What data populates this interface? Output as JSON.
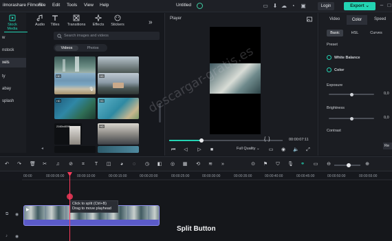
{
  "app": {
    "name": "ilmorashare Filmora",
    "menu": [
      "File",
      "Edit",
      "Tools",
      "View",
      "Help"
    ],
    "project_title": "Untitled",
    "login_label": "Login",
    "export_label": "Export"
  },
  "sidebar": {
    "items": [
      "w",
      "nstock",
      "xels",
      "ty",
      "abay",
      "splash"
    ]
  },
  "media_tabs": [
    "Stock Media",
    "Audio",
    "Titles",
    "Transitions",
    "Effects",
    "Stickers"
  ],
  "search": {
    "placeholder": "Search images and videos"
  },
  "media_type_tabs": {
    "videos": "Videos",
    "photos": "Photos"
  },
  "thumbnails": [
    {
      "badge": ""
    },
    {
      "badge": ""
    },
    {
      "badge": "HD"
    },
    {
      "badge": "HD"
    },
    {
      "badge": "HD"
    },
    {
      "badge": "HD"
    },
    {
      "badge": "2160x4096"
    },
    {
      "badge": "HD"
    },
    {
      "badge": ""
    },
    {
      "badge": ""
    }
  ],
  "player": {
    "label": "Player",
    "timecode": "00:00:07:11",
    "quality": "Full Quality"
  },
  "right_panel": {
    "tabs": [
      "Video",
      "Color",
      "Speed"
    ],
    "sub_tabs": [
      "Basic",
      "HSL",
      "Curves"
    ],
    "preset_label": "Preset",
    "white_balance_label": "White Balance",
    "color_label": "Color",
    "exposure_label": "Exposure",
    "exposure_value": "0,0",
    "brightness_label": "Brightness",
    "brightness_value": "0,0",
    "contrast_label": "Contrast",
    "reset_label": "Re",
    "exposure_level": 0.5,
    "brightness_level": 0.5
  },
  "timeline": {
    "ruler": [
      "00:00",
      "00:00:05:00",
      "00:00:10:00",
      "00:00:15:00",
      "00:00:20:00",
      "00:00:25:00",
      "00:00:30:00",
      "00:00:35:00",
      "00:00:40:00",
      "00:00:45:00",
      "00:00:50:00",
      "00:00:55:00"
    ],
    "tooltip_line1": "Click to split (Ctrl+B)",
    "tooltip_line2": "Drag to move playhead"
  },
  "caption": "Split Button",
  "watermark": "descargar-gratis.es",
  "colors": {
    "accent": "#23d4b3",
    "clip": "#6f6fd8",
    "playhead": "#ff3b5c"
  }
}
